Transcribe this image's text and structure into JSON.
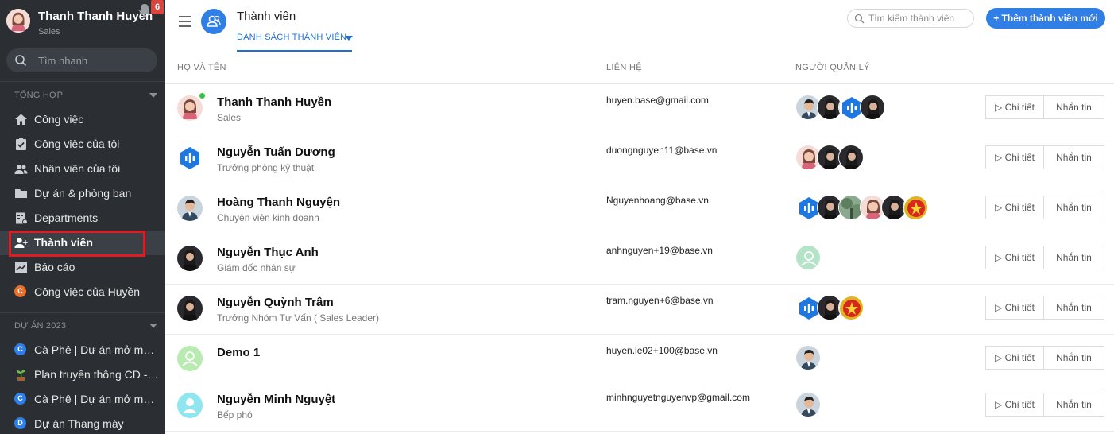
{
  "sidebar": {
    "user_name": "Thanh Thanh Huyền",
    "user_role": "Sales",
    "notification_count": "6",
    "search_placeholder": "Tìm nhanh",
    "section_general": "TỔNG HỢP",
    "items": [
      {
        "label": "Công việc",
        "icon": "home-icon"
      },
      {
        "label": "Công việc của tôi",
        "icon": "task-check-icon"
      },
      {
        "label": "Nhân viên của tôi",
        "icon": "people-icon"
      },
      {
        "label": "Dự án & phòng ban",
        "icon": "folder-icon"
      },
      {
        "label": "Departments",
        "icon": "department-icon"
      },
      {
        "label": "Thành viên",
        "icon": "members-icon"
      },
      {
        "label": "Báo cáo",
        "icon": "chart-icon"
      },
      {
        "label": "Công việc của Huyền",
        "icon": "letter-c-icon",
        "letter": "C"
      }
    ],
    "section_projects": "DỰ ÁN 2023",
    "projects": [
      {
        "label": "Cà Phê | Dự án mở mới c...",
        "letter": "C",
        "color": "#2f7fe6"
      },
      {
        "label": "Plan truyền thông CD - M...",
        "icon": "plant-icon"
      },
      {
        "label": "Cà Phê | Dự án mở mở V...",
        "letter": "C",
        "color": "#2f7fe6"
      },
      {
        "label": "Dự án Thang máy",
        "letter": "D",
        "color": "#2f7fe6"
      }
    ]
  },
  "header": {
    "title": "Thành viên",
    "tab": "DANH SÁCH THÀNH VIÊN",
    "search_placeholder": "Tìm kiếm thành viên",
    "add_button": "+ Thêm thành viên mới"
  },
  "table": {
    "columns": [
      "HỌ VÀ TÊN",
      "LIÊN HỆ",
      "NGƯỜI QUẢN LÝ"
    ],
    "detail_label": "▷ Chi tiết",
    "message_label": "Nhắn tin",
    "rows": [
      {
        "name": "Thanh Thanh Huyền",
        "title": "Sales",
        "contact": "huyen.base@gmail.com"
      },
      {
        "name": "Nguyễn Tuấn Dương",
        "title": "Trưởng phòng kỹ thuật",
        "contact": "duongnguyen11@base.vn"
      },
      {
        "name": "Hoàng Thanh Nguyện",
        "title": "Chuyên viên kinh doanh",
        "contact": "Nguyenhoang@base.vn"
      },
      {
        "name": "Nguyễn Thục Anh",
        "title": "Giám đốc nhân sự",
        "contact": "anhnguyen+19@base.vn"
      },
      {
        "name": "Nguyễn Quỳnh Trâm",
        "title": "Trưởng Nhóm Tư Vấn ( Sales Leader)",
        "contact": "tram.nguyen+6@base.vn"
      },
      {
        "name": "Demo 1",
        "title": "",
        "contact": "huyen.le02+100@base.vn"
      },
      {
        "name": "Nguyễn Minh Nguyệt",
        "title": "Bếp phó",
        "contact": "minhnguyetnguyenvp@gmail.com"
      }
    ]
  },
  "colors": {
    "accent": "#2f7fe6",
    "sidebar_bg": "#2b2f33",
    "highlight": "#e01b22",
    "online": "#38c443"
  }
}
